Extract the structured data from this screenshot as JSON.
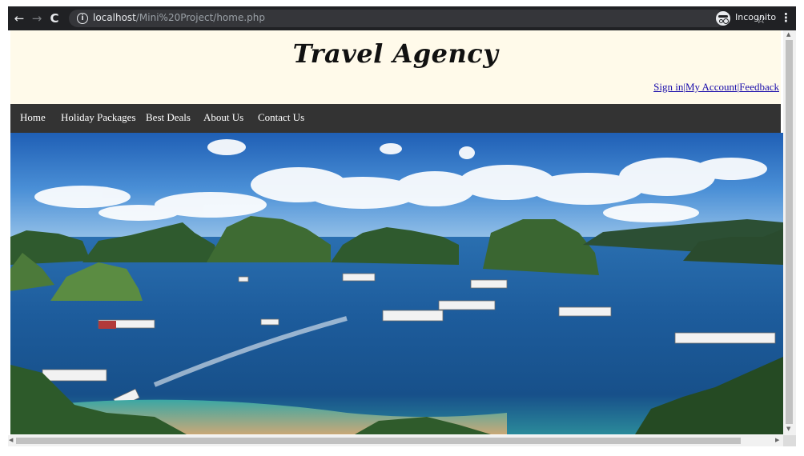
{
  "browser": {
    "back_icon": "←",
    "forward_icon": "→",
    "reload_icon": "C",
    "info_icon": "i",
    "url_host": "localhost",
    "url_path": "/Mini%20Project/home.php",
    "star_icon": "☆",
    "profile_label": "Incognito",
    "menu_icon": "⋮"
  },
  "header": {
    "title": "Travel Agency",
    "links": [
      "Sign in",
      "My Account",
      "Feedback"
    ],
    "separator": "|"
  },
  "nav": {
    "items": [
      "Home",
      "Holiday Packages",
      "Best Deals",
      "About Us",
      "Contact Us"
    ]
  },
  "colors": {
    "header_bg": "#fffaea",
    "nav_bg": "#333333",
    "link": "#1a0dab",
    "chrome": "#202124"
  }
}
